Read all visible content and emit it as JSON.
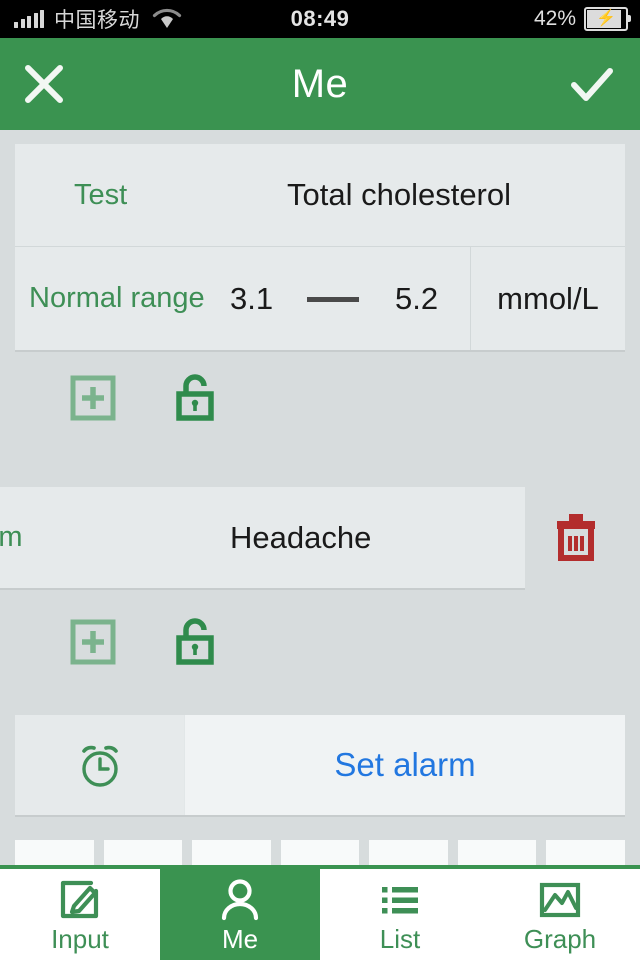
{
  "status_bar": {
    "signal_icon": "signal-bars-icon",
    "carrier": "中国移动",
    "wifi_icon": "wifi-icon",
    "time": "08:49",
    "battery_percent": "42%",
    "battery_icon": "battery-charging-icon"
  },
  "nav_bar": {
    "title": "Me",
    "close_icon": "close-icon",
    "confirm_icon": "check-icon",
    "background_color": "#3a9350"
  },
  "test_card": {
    "test_label": "Test",
    "test_value": "Total cholesterol",
    "range_label": "Normal range",
    "range_low": "3.1",
    "range_separator": "—",
    "range_high": "5.2",
    "range_unit": "mmol/L"
  },
  "icon_rows": [
    {
      "add_icon": "add-box-icon",
      "lock_icon": "unlock-icon"
    },
    {
      "add_icon": "add-box-icon",
      "lock_icon": "unlock-icon"
    }
  ],
  "symptom_card": {
    "label": "ptom",
    "value": "Headache",
    "delete_icon": "trash-icon",
    "delete_color": "#b32d2d"
  },
  "alarm_card": {
    "icon": "alarm-clock-icon",
    "label": "Set alarm",
    "label_color": "#2277e0"
  },
  "cell_strip": {
    "cells": [
      "",
      "",
      "",
      "",
      "",
      "",
      ""
    ]
  },
  "tab_bar": {
    "items": [
      {
        "label": "Input",
        "icon": "edit-square-icon",
        "active": false
      },
      {
        "label": "Me",
        "icon": "person-icon",
        "active": true
      },
      {
        "label": "List",
        "icon": "list-icon",
        "active": false
      },
      {
        "label": "Graph",
        "icon": "image-chart-icon",
        "active": false
      }
    ],
    "accent_color": "#3a9350"
  }
}
